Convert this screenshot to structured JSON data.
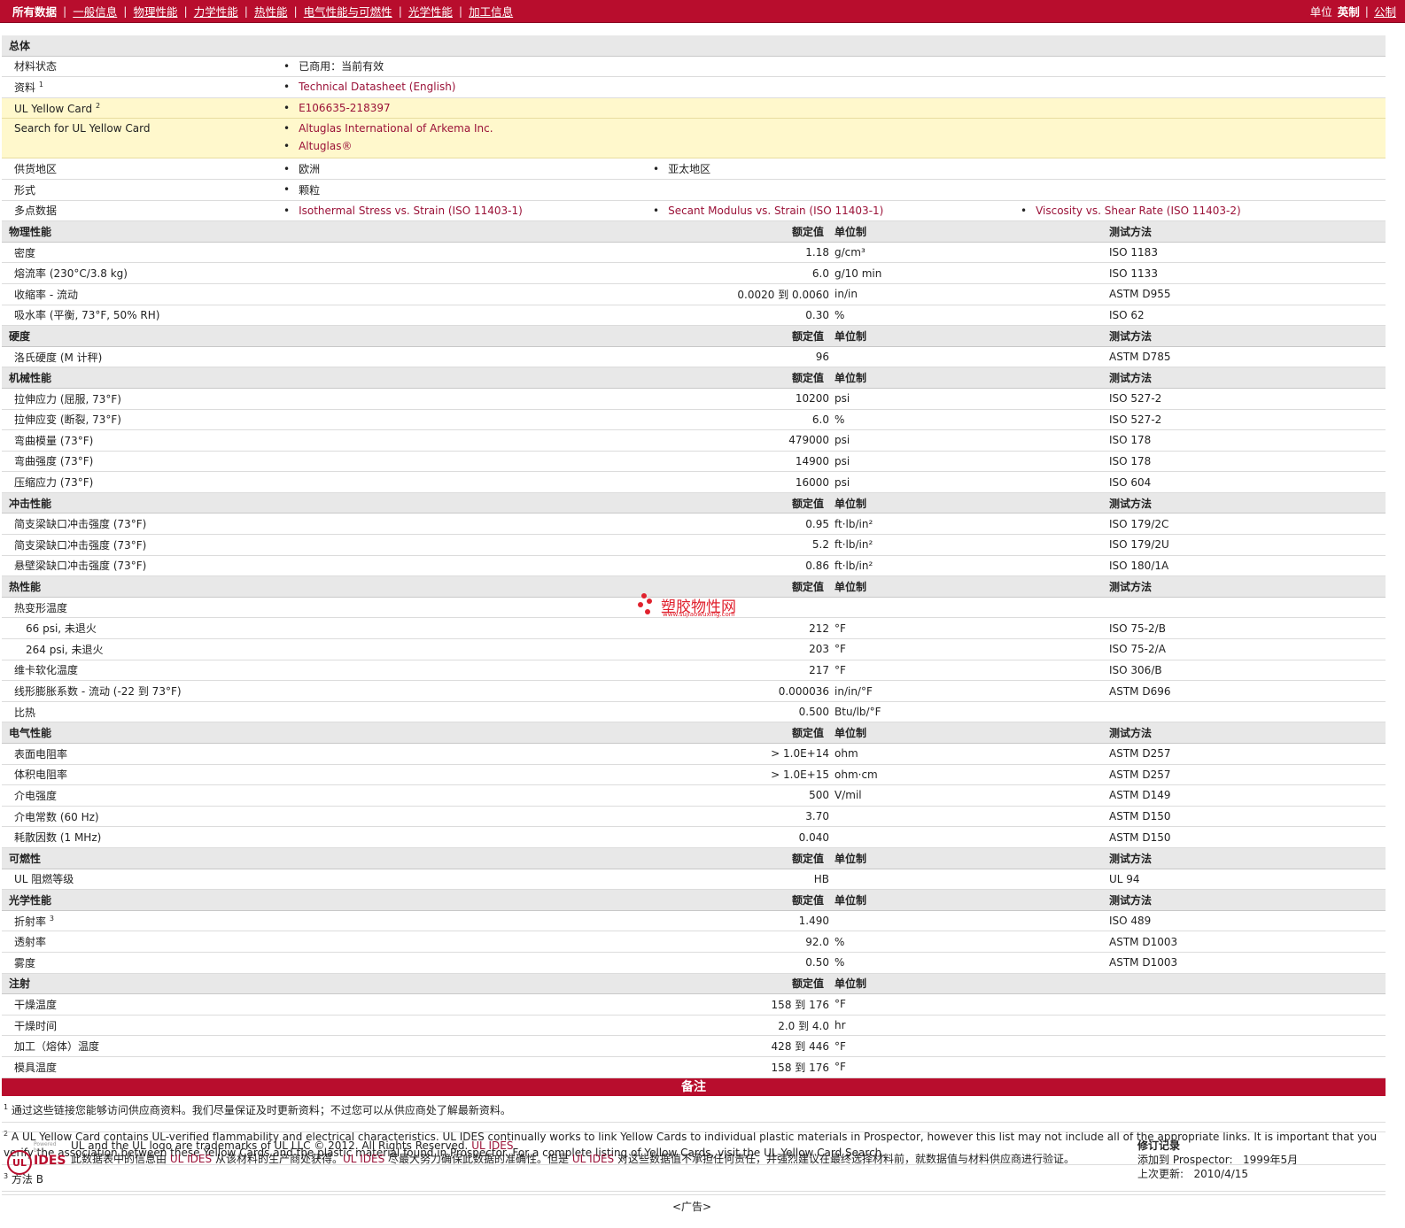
{
  "nav": {
    "items": [
      "所有数据",
      "一般信息",
      "物理性能",
      "力学性能",
      "热性能",
      "电气性能与可燃性",
      "光学性能",
      "加工信息"
    ],
    "units_label": "单位",
    "units_active": "英制",
    "units_other": "公制"
  },
  "general": {
    "title": "总体",
    "material_status_label": "材料状态",
    "material_status": "已商用：当前有效",
    "docs_label": "资料",
    "docs_sup": "1",
    "docs_link": "Technical Datasheet (English)",
    "ulcard_label": "UL Yellow Card",
    "ulcard_sup": "2",
    "ulcard_link": "E106635-218397",
    "search_label": "Search for UL Yellow Card",
    "search_link1": "Altuglas International of Arkema Inc.",
    "search_link2": "Altuglas®",
    "supply_label": "供货地区",
    "supply1": "欧洲",
    "supply2": "亚太地区",
    "form_label": "形式",
    "form": "颗粒",
    "multi_label": "多点数据",
    "multi1": "Isothermal Stress vs. Strain (ISO 11403-1)",
    "multi2": "Secant Modulus vs. Strain (ISO 11403-1)",
    "multi3": "Viscosity vs. Shear Rate (ISO 11403-2)"
  },
  "headers": {
    "value": "额定值",
    "unit": "单位制",
    "test": "测试方法"
  },
  "sections": {
    "physical": {
      "title": "物理性能",
      "rows": [
        {
          "name": "密度",
          "value": "1.18",
          "unit": "g/cm³",
          "test": "ISO 1183"
        },
        {
          "name": "熔流率 (230°C/3.8 kg)",
          "value": "6.0",
          "unit": "g/10 min",
          "test": "ISO 1133"
        },
        {
          "name": "收缩率 - 流动",
          "value": "0.0020 到 0.0060",
          "unit": "in/in",
          "test": "ASTM D955"
        },
        {
          "name": "吸水率 (平衡, 73°F, 50% RH)",
          "value": "0.30",
          "unit": "%",
          "test": "ISO 62"
        }
      ]
    },
    "hardness": {
      "title": "硬度",
      "rows": [
        {
          "name": "洛氏硬度 (M 计秤)",
          "value": "96",
          "unit": "",
          "test": "ASTM D785"
        }
      ]
    },
    "mechanical": {
      "title": "机械性能",
      "rows": [
        {
          "name": "拉伸应力 (屈服, 73°F)",
          "value": "10200",
          "unit": "psi",
          "test": "ISO 527-2"
        },
        {
          "name": "拉伸应变 (断裂, 73°F)",
          "value": "6.0",
          "unit": "%",
          "test": "ISO 527-2"
        },
        {
          "name": "弯曲模量 (73°F)",
          "value": "479000",
          "unit": "psi",
          "test": "ISO 178"
        },
        {
          "name": "弯曲强度 (73°F)",
          "value": "14900",
          "unit": "psi",
          "test": "ISO 178"
        },
        {
          "name": "压缩应力 (73°F)",
          "value": "16000",
          "unit": "psi",
          "test": "ISO 604"
        }
      ]
    },
    "impact": {
      "title": "冲击性能",
      "rows": [
        {
          "name": "简支梁缺口冲击强度 (73°F)",
          "value": "0.95",
          "unit": "ft·lb/in²",
          "test": "ISO 179/2C"
        },
        {
          "name": "简支梁缺口冲击强度 (73°F)",
          "value": "5.2",
          "unit": "ft·lb/in²",
          "test": "ISO 179/2U"
        },
        {
          "name": "悬壁梁缺口冲击强度 (73°F)",
          "value": "0.86",
          "unit": "ft·lb/in²",
          "test": "ISO 180/1A"
        }
      ]
    },
    "thermal": {
      "title": "热性能",
      "hdt_label": "热变形温度",
      "rows": [
        {
          "name": "66 psi, 未退火",
          "value": "212",
          "unit": "°F",
          "test": "ISO 75-2/B"
        },
        {
          "name": "264 psi, 未退火",
          "value": "203",
          "unit": "°F",
          "test": "ISO 75-2/A"
        },
        {
          "name": "维卡软化温度",
          "value": "217",
          "unit": "°F",
          "test": "ISO 306/B"
        },
        {
          "name": "线形膨胀系数 - 流动 (-22 到 73°F)",
          "value": "0.000036",
          "unit": "in/in/°F",
          "test": "ASTM D696"
        },
        {
          "name": "比热",
          "value": "0.500",
          "unit": "Btu/lb/°F",
          "test": ""
        }
      ]
    },
    "electrical": {
      "title": "电气性能",
      "rows": [
        {
          "name": "表面电阻率",
          "value": "> 1.0E+14",
          "unit": "ohm",
          "test": "ASTM D257"
        },
        {
          "name": "体积电阻率",
          "value": "> 1.0E+15",
          "unit": "ohm·cm",
          "test": "ASTM D257"
        },
        {
          "name": "介电强度",
          "value": "500",
          "unit": "V/mil",
          "test": "ASTM D149"
        },
        {
          "name": "介电常数 (60 Hz)",
          "value": "3.70",
          "unit": "",
          "test": "ASTM D150"
        },
        {
          "name": "耗散因数 (1 MHz)",
          "value": "0.040",
          "unit": "",
          "test": "ASTM D150"
        }
      ]
    },
    "flammability": {
      "title": "可燃性",
      "rows": [
        {
          "name": "UL 阻燃等级",
          "value": "HB",
          "unit": "",
          "test": "UL 94"
        }
      ]
    },
    "optical": {
      "title": "光学性能",
      "rows": [
        {
          "name": "折射率",
          "sup": "3",
          "value": "1.490",
          "unit": "",
          "test": "ISO 489"
        },
        {
          "name": "透射率",
          "value": "92.0",
          "unit": "%",
          "test": "ASTM D1003"
        },
        {
          "name": "雾度",
          "value": "0.50",
          "unit": "%",
          "test": "ASTM D1003"
        }
      ]
    },
    "injection": {
      "title": "注射",
      "rows": [
        {
          "name": "干燥温度",
          "value": "158 到 176",
          "unit": "°F",
          "test": ""
        },
        {
          "name": "干燥时间",
          "value": "2.0 到 4.0",
          "unit": "hr",
          "test": ""
        },
        {
          "name": "加工（熔体）温度",
          "value": "428 到 446",
          "unit": "°F",
          "test": ""
        },
        {
          "name": "模具温度",
          "value": "158 到 176",
          "unit": "°F",
          "test": ""
        }
      ]
    }
  },
  "notes": {
    "title": "备注",
    "n1_sup": "1",
    "n1": "通过这些链接您能够访问供应商资料。我们尽量保证及时更新资料；不过您可以从供应商处了解最新资料。",
    "n2_sup": "2",
    "n2": "A UL Yellow Card contains UL-verified flammability and electrical characteristics. UL IDES continually works to link Yellow Cards to individual plastic materials in Prospector, however this list may not include all of the appropriate links. It is important that you verify the association between these Yellow Cards and the plastic material found in Prospector. For a complete listing of Yellow Cards, visit the UL Yellow Card Search.",
    "n3_sup": "3",
    "n3": "方法 B"
  },
  "footer": {
    "logo_powered": "Powered by",
    "logo_ul": "UL",
    "logo_ides": "IDES",
    "line1": "UL and the UL logo are trademarks of UL LLC © 2012. All Rights Reserved.",
    "line1_link": "UL IDES",
    "line2a": "此数据表中的信息由",
    "line2_link1": "UL IDES",
    "line2b": "从该材料的生产商处获得。",
    "line2_link2": "UL IDES",
    "line2c": "尽最大努力确保此数据的准确性。但是",
    "line2_link3": "UL IDES",
    "line2d": "对这些数据值不承担任何责任，并强烈建议在最终选择材料前，就数据值与材料供应商进行验证。",
    "rev_title": "修订记录",
    "rev_added_label": "添加到 Prospector:",
    "rev_added": "1999年5月",
    "rev_updated_label": "上次更新:",
    "rev_updated": "2010/4/15",
    "ad": "<广告>"
  },
  "watermark": {
    "text": "塑胶物性网",
    "url": "www.sujiaowuxing.com"
  }
}
